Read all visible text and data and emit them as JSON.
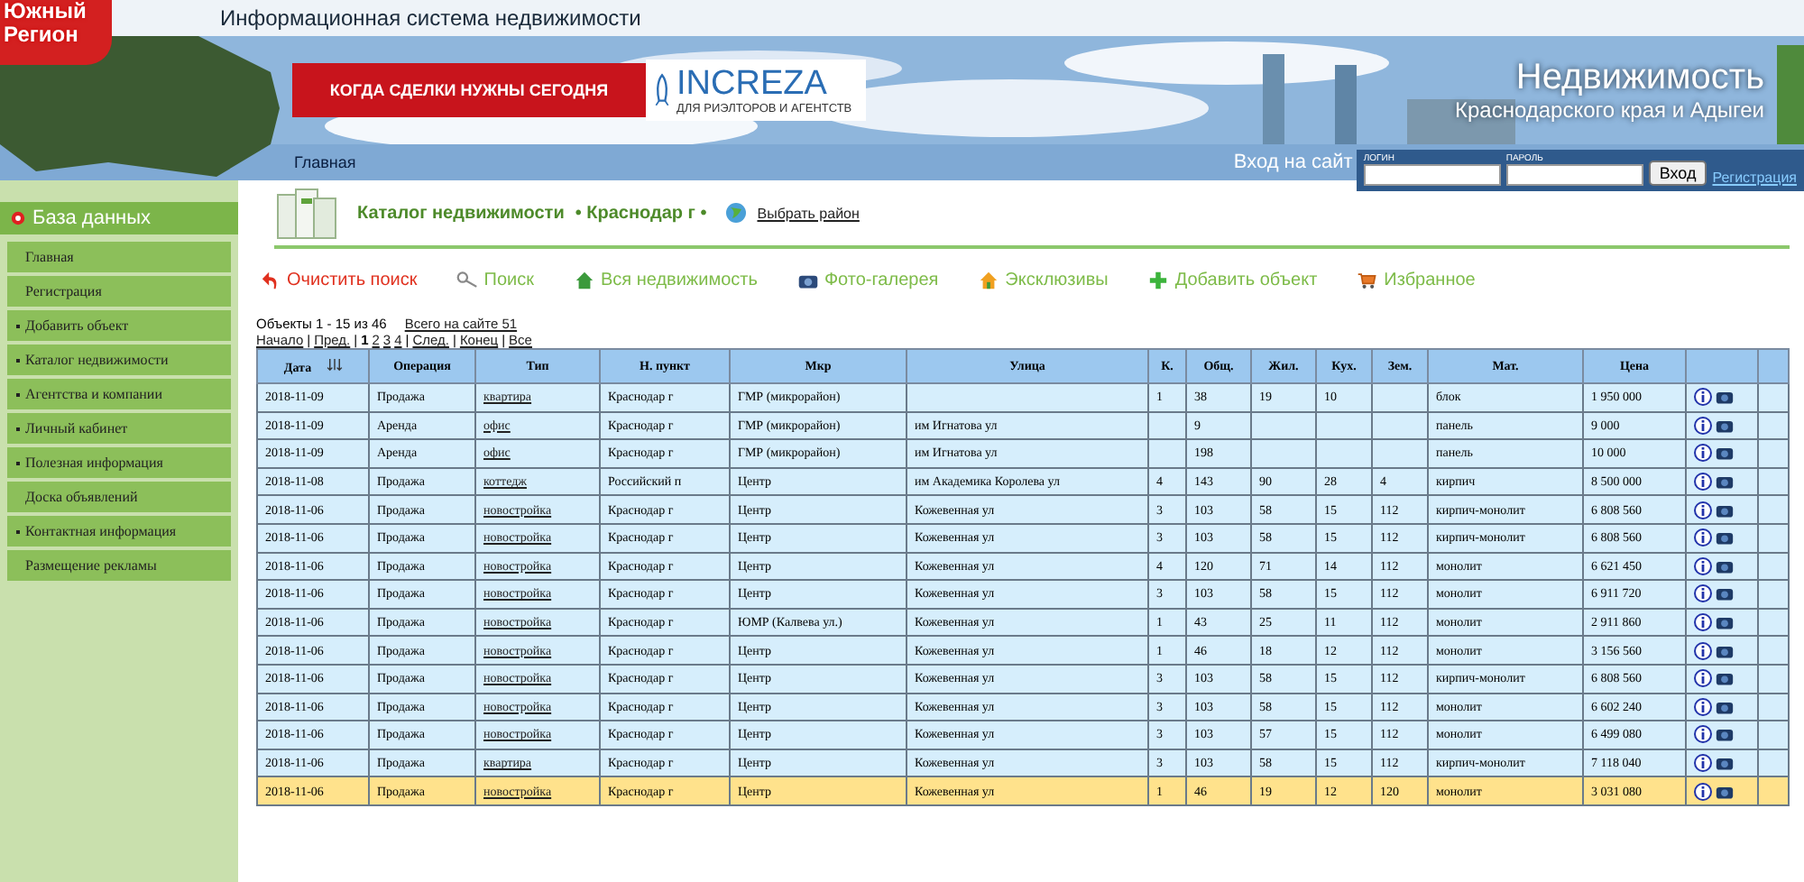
{
  "header": {
    "logo": [
      "Южный",
      "Регион"
    ],
    "site_title": "Информационная система недвижимости",
    "ad": {
      "slogan": "КОГДА СДЕЛКИ НУЖНЫ СЕГОДНЯ",
      "brand": "INCREZA",
      "tagline": "ДЛЯ РИЭЛТОРОВ И АГЕНТСТВ"
    },
    "heading": "Недвижимость",
    "subheading": "Краснодарского края и Адыгеи"
  },
  "nav": {
    "link": "Главная",
    "login_title": "Вход на сайт",
    "login_label": "ЛОГИН",
    "password_label": "ПАРОЛЬ",
    "login_button": "Вход",
    "register_link": "Регистрация"
  },
  "sidebar": {
    "title": "База данных",
    "items": [
      {
        "label": "Главная",
        "submenu": false
      },
      {
        "label": "Регистрация",
        "submenu": false
      },
      {
        "label": "Добавить объект",
        "submenu": true
      },
      {
        "label": "Каталог недвижимости",
        "submenu": true
      },
      {
        "label": "Агентства и компании",
        "submenu": true
      },
      {
        "label": "Личный кабинет",
        "submenu": true
      },
      {
        "label": "Полезная информация",
        "submenu": true
      },
      {
        "label": "Доска объявлений",
        "submenu": false
      },
      {
        "label": "Контактная информация",
        "submenu": true
      },
      {
        "label": "Размещение рекламы",
        "submenu": false
      }
    ]
  },
  "catalog": {
    "title": "Каталог недвижимости",
    "city": "• Краснодар г •",
    "region_link": "Выбрать район"
  },
  "toolbar": [
    {
      "kind": "clear",
      "label": "Очистить поиск"
    },
    {
      "kind": "search",
      "label": "Поиск"
    },
    {
      "kind": "all",
      "label": "Вся недвижимость"
    },
    {
      "kind": "gallery",
      "label": "Фото-галерея"
    },
    {
      "kind": "exclusive",
      "label": "Эксклюзивы"
    },
    {
      "kind": "add",
      "label": "Добавить объект"
    },
    {
      "kind": "favorites",
      "label": "Избранное"
    }
  ],
  "summary": {
    "objects": "Объекты 1 - 15 из 46",
    "total_link": "Всего на сайте 51"
  },
  "pagination": {
    "separator": "|",
    "first": "Начало",
    "prev": "Пред.",
    "pages": [
      {
        "label": "1",
        "selected": true
      },
      {
        "label": "2",
        "selected": false
      },
      {
        "label": "3",
        "selected": false
      },
      {
        "label": "4",
        "selected": false
      }
    ],
    "next": "След.",
    "last": "Конец",
    "all": "Все"
  },
  "table": {
    "columns": [
      "Дата",
      "Операция",
      "Тип",
      "Н. пункт",
      "Мкр",
      "Улица",
      "К.",
      "Общ.",
      "Жил.",
      "Кух.",
      "Зем.",
      "Мат.",
      "Цена"
    ],
    "rows": [
      {
        "selected": false,
        "cells": [
          "2018-11-09",
          "Продажа",
          "квартира",
          "Краснодар г",
          "ГМР (микрорайон)",
          "",
          "1",
          "38",
          "19",
          "10",
          "",
          "блок",
          "1 950 000"
        ]
      },
      {
        "selected": false,
        "cells": [
          "2018-11-09",
          "Аренда",
          "офис",
          "Краснодар г",
          "ГМР (микрорайон)",
          "им Игнатова ул",
          "",
          "9",
          "",
          "",
          "",
          "панель",
          "9 000"
        ]
      },
      {
        "selected": false,
        "cells": [
          "2018-11-09",
          "Аренда",
          "офис",
          "Краснодар г",
          "ГМР (микрорайон)",
          "им Игнатова ул",
          "",
          "198",
          "",
          "",
          "",
          "панель",
          "10 000"
        ]
      },
      {
        "selected": false,
        "cells": [
          "2018-11-08",
          "Продажа",
          "коттедж",
          "Российский п",
          "Центр",
          "им Академика Королева ул",
          "4",
          "143",
          "90",
          "28",
          "4",
          "кирпич",
          "8 500 000"
        ]
      },
      {
        "selected": false,
        "cells": [
          "2018-11-06",
          "Продажа",
          "новостройка",
          "Краснодар г",
          "Центр",
          "Кожевенная ул",
          "3",
          "103",
          "58",
          "15",
          "112",
          "кирпич-монолит",
          "6 808 560"
        ]
      },
      {
        "selected": false,
        "cells": [
          "2018-11-06",
          "Продажа",
          "новостройка",
          "Краснодар г",
          "Центр",
          "Кожевенная ул",
          "3",
          "103",
          "58",
          "15",
          "112",
          "кирпич-монолит",
          "6 808 560"
        ]
      },
      {
        "selected": false,
        "cells": [
          "2018-11-06",
          "Продажа",
          "новостройка",
          "Краснодар г",
          "Центр",
          "Кожевенная ул",
          "4",
          "120",
          "71",
          "14",
          "112",
          "монолит",
          "6 621 450"
        ]
      },
      {
        "selected": false,
        "cells": [
          "2018-11-06",
          "Продажа",
          "новостройка",
          "Краснодар г",
          "Центр",
          "Кожевенная ул",
          "3",
          "103",
          "58",
          "15",
          "112",
          "монолит",
          "6 911 720"
        ]
      },
      {
        "selected": false,
        "cells": [
          "2018-11-06",
          "Продажа",
          "новостройка",
          "Краснодар г",
          "ЮМР (Калвева ул.)",
          "Кожевенная ул",
          "1",
          "43",
          "25",
          "11",
          "112",
          "монолит",
          "2 911 860"
        ]
      },
      {
        "selected": false,
        "cells": [
          "2018-11-06",
          "Продажа",
          "новостройка",
          "Краснодар г",
          "Центр",
          "Кожевенная ул",
          "1",
          "46",
          "18",
          "12",
          "112",
          "монолит",
          "3 156 560"
        ]
      },
      {
        "selected": false,
        "cells": [
          "2018-11-06",
          "Продажа",
          "новостройка",
          "Краснодар г",
          "Центр",
          "Кожевенная ул",
          "3",
          "103",
          "58",
          "15",
          "112",
          "кирпич-монолит",
          "6 808 560"
        ]
      },
      {
        "selected": false,
        "cells": [
          "2018-11-06",
          "Продажа",
          "новостройка",
          "Краснодар г",
          "Центр",
          "Кожевенная ул",
          "3",
          "103",
          "58",
          "15",
          "112",
          "монолит",
          "6 602 240"
        ]
      },
      {
        "selected": false,
        "cells": [
          "2018-11-06",
          "Продажа",
          "новостройка",
          "Краснодар г",
          "Центр",
          "Кожевенная ул",
          "3",
          "103",
          "57",
          "15",
          "112",
          "монолит",
          "6 499 080"
        ]
      },
      {
        "selected": false,
        "cells": [
          "2018-11-06",
          "Продажа",
          "квартира",
          "Краснодар г",
          "Центр",
          "Кожевенная ул",
          "3",
          "103",
          "58",
          "15",
          "112",
          "кирпич-монолит",
          "7 118 040"
        ]
      },
      {
        "selected": true,
        "cells": [
          "2018-11-06",
          "Продажа",
          "новостройка",
          "Краснодар г",
          "Центр",
          "Кожевенная ул",
          "1",
          "46",
          "19",
          "12",
          "120",
          "монолит",
          "3 031 080"
        ]
      }
    ]
  }
}
